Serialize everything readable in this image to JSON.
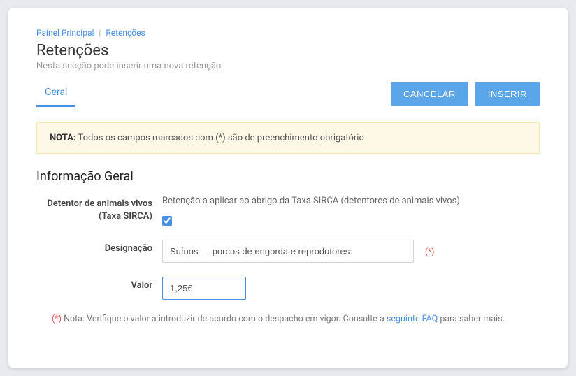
{
  "breadcrumb": {
    "item1": "Painel Principal",
    "sep": "|",
    "item2": "Retenções"
  },
  "header": {
    "title": "Retenções",
    "subtitle": "Nesta secção pode inserir uma nova retenção"
  },
  "tabs": {
    "geral": "Geral"
  },
  "actions": {
    "cancel": "CANCELAR",
    "insert": "INSERIR"
  },
  "note": {
    "label": "NOTA:",
    "text": " Todos os campos marcados com (*) são de preenchimento obrigatório"
  },
  "section": {
    "title": "Informação Geral"
  },
  "form": {
    "detentor": {
      "label": "Detentor de animais vivos (Taxa SIRCA)",
      "help": "Retenção a aplicar ao abrigo da Taxa SIRCA (detentores de animais vivos)",
      "checked": true
    },
    "designacao": {
      "label": "Designação",
      "value": "Suínos — porcos de engorda e reprodutores:",
      "required_mark": "(*)"
    },
    "valor": {
      "label": "Valor",
      "value": "1,25€"
    }
  },
  "footnote": {
    "ast": "(*)",
    "pre": " Nota: Verifique o valor a introduzir de acordo com o despacho em vigor. Consulte a ",
    "link": "seguinte FAQ",
    "post": " para saber mais."
  }
}
